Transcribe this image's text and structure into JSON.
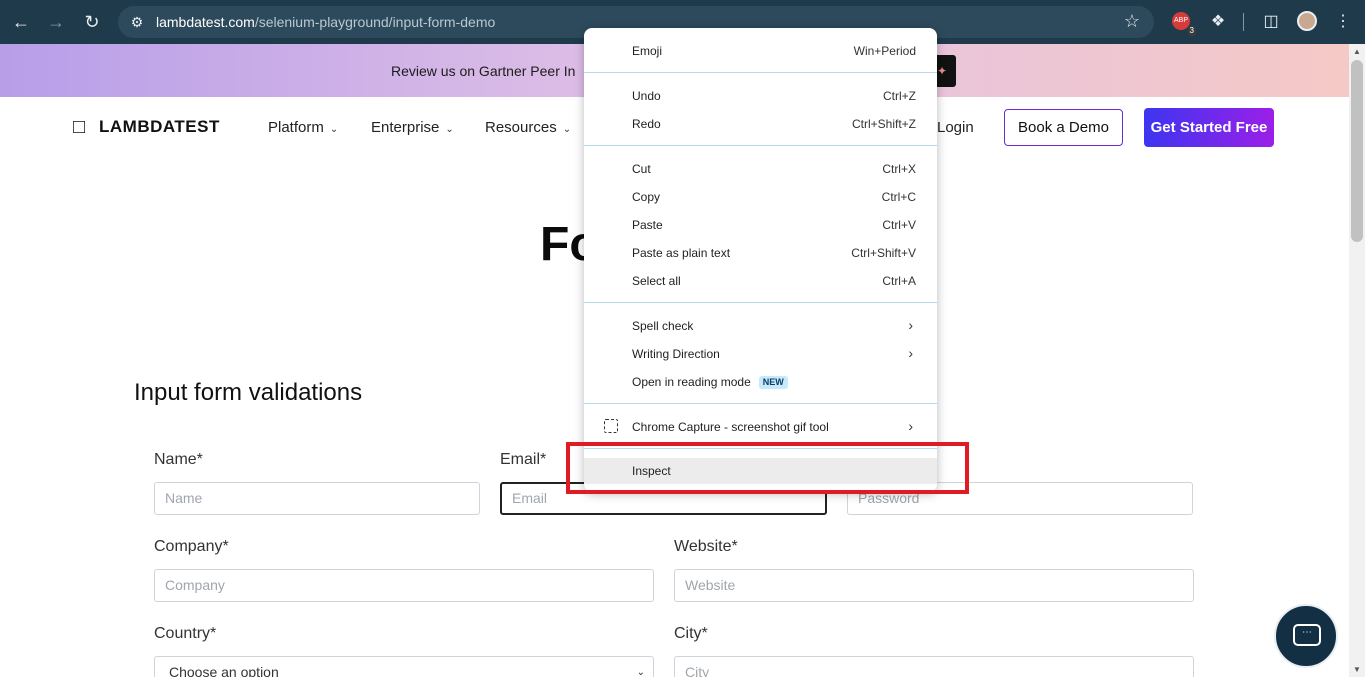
{
  "browser": {
    "url_host": "lambdatest.com",
    "url_path": "/selenium-playground/input-form-demo",
    "abp_label": "ABP",
    "abp_count": "3"
  },
  "banner": {
    "text": "Review us on Gartner Peer In"
  },
  "header": {
    "logo": "LAMBDATEST",
    "menu": [
      "Platform",
      "Enterprise",
      "Resources"
    ],
    "login": "Login",
    "book_demo": "Book a Demo",
    "get_started": "Get Started Free"
  },
  "page": {
    "title_fragment": "Fo",
    "section_title": "Input form validations"
  },
  "form": {
    "name_label": "Name*",
    "name_placeholder": "Name",
    "email_label": "Email*",
    "email_placeholder": "Email",
    "password_placeholder": "Password",
    "company_label": "Company*",
    "company_placeholder": "Company",
    "website_label": "Website*",
    "website_placeholder": "Website",
    "country_label": "Country*",
    "country_value": "Choose an option",
    "city_label": "City*",
    "city_placeholder": "City"
  },
  "context_menu": {
    "items": [
      {
        "label": "Emoji",
        "shortcut": "Win+Period"
      },
      {
        "label": "Undo",
        "shortcut": "Ctrl+Z"
      },
      {
        "label": "Redo",
        "shortcut": "Ctrl+Shift+Z"
      },
      {
        "label": "Cut",
        "shortcut": "Ctrl+X"
      },
      {
        "label": "Copy",
        "shortcut": "Ctrl+C"
      },
      {
        "label": "Paste",
        "shortcut": "Ctrl+V"
      },
      {
        "label": "Paste as plain text",
        "shortcut": "Ctrl+Shift+V"
      },
      {
        "label": "Select all",
        "shortcut": "Ctrl+A"
      },
      {
        "label": "Spell check",
        "shortcut": ""
      },
      {
        "label": "Writing Direction",
        "shortcut": ""
      },
      {
        "label": "Open in reading mode",
        "shortcut": "",
        "badge": "NEW"
      },
      {
        "label": "Chrome Capture - screenshot  gif tool",
        "shortcut": ""
      },
      {
        "label": "Inspect",
        "shortcut": ""
      }
    ]
  },
  "colors": {
    "browser_bar": "#1f3a4b",
    "highlight": "#e01b24",
    "cta_gradient_start": "#3d35f0",
    "cta_gradient_end": "#9b1fe8"
  }
}
